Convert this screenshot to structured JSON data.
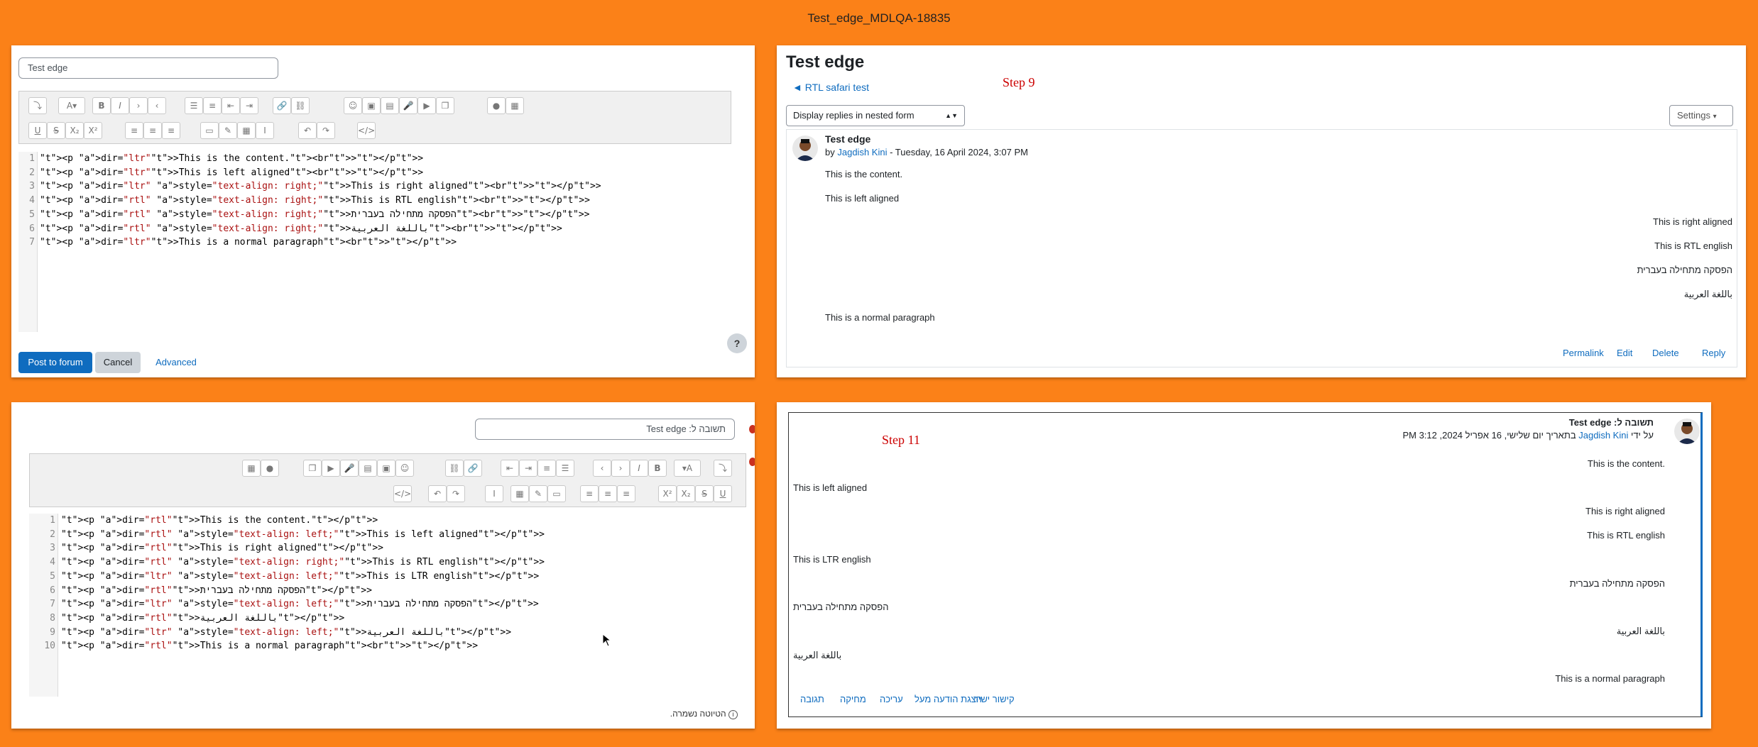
{
  "window_title": "Test_edge_MDLQA-18835",
  "panel_top_left": {
    "subject_value": "Test edge",
    "code_lines": [
      "<p dir=\"ltr\">This is the content.<br></p>",
      "<p dir=\"ltr\">This is left aligned<br></p>",
      "<p dir=\"ltr\" style=\"text-align: right;\">This is right aligned<br></p>",
      "<p dir=\"rtl\" style=\"text-align: right;\">This is RTL english<br></p>",
      "<p dir=\"rtl\" style=\"text-align: right;\">הפסקה מתחילה בעברית<br></p>",
      "<p dir=\"rtl\" style=\"text-align: right;\">باللغة العربية<br></p>",
      "<p dir=\"ltr\">This is a normal paragraph<br></p>"
    ],
    "post_button": "Post to forum",
    "cancel_button": "Cancel",
    "advanced_link": "Advanced",
    "help_icon": "?"
  },
  "panel_top_right": {
    "heading": "Test edge",
    "back_link": "◄ RTL safari test",
    "step_label": "Step 9",
    "display_select": "Display replies in nested form",
    "settings_button": "Settings",
    "post": {
      "subject": "Test edge",
      "by_prefix": "by",
      "author": "Jagdish Kini",
      "date": " - Tuesday, 16 April 2024, 3:07 PM",
      "paragraphs": [
        {
          "text": "This is the content.",
          "align": "left"
        },
        {
          "text": "This is left aligned",
          "align": "left"
        },
        {
          "text": "This is right aligned",
          "align": "right"
        },
        {
          "text": "This is RTL english",
          "align": "right"
        },
        {
          "text": "הפסקה מתחילה בעברית",
          "align": "right"
        },
        {
          "text": "باللغة العربية",
          "align": "right"
        },
        {
          "text": "This is a normal paragraph",
          "align": "left"
        }
      ],
      "actions": [
        "Permalink",
        "Edit",
        "Delete",
        "Reply"
      ]
    }
  },
  "panel_bottom_left": {
    "subject_value": "תשובה ל: Test edge",
    "code_lines": [
      "<p dir=\"rtl\">This is the content.</p>",
      "<p dir=\"rtl\" style=\"text-align: left;\">This is left aligned</p>",
      "<p dir=\"rtl\">This is right aligned</p>",
      "<p dir=\"rtl\" style=\"text-align: right;\">This is RTL english</p>",
      "<p dir=\"ltr\" style=\"text-align: left;\">This is LTR english</p>",
      "<p dir=\"rtl\">הפסקה מתחילה בעברית</p>",
      "<p dir=\"ltr\" style=\"text-align: left;\">הפסקה מתחילה בעברית</p>",
      "<p dir=\"rtl\">باللغة العربية</p>",
      "<p dir=\"ltr\" style=\"text-align: left;\">باللغة العربية</p>",
      "<p dir=\"rtl\">This is a normal paragraph<br></p>"
    ],
    "autosave_notice": "הטיוטה נשמרה."
  },
  "panel_bottom_right": {
    "step_label": "Step 11",
    "post": {
      "subject": "תשובה ל: Test edge",
      "by_prefix": "על ידי",
      "author": "Jagdish Kini",
      "date": "בתאריך יום שלישי, 16 אפריל 2024, 3:12 PM",
      "paragraphs": [
        {
          "text": "This is the content.",
          "align": "right"
        },
        {
          "text": "This is left aligned",
          "align": "left"
        },
        {
          "text": "This is right aligned",
          "align": "right"
        },
        {
          "text": "This is RTL english",
          "align": "right"
        },
        {
          "text": "This is LTR english",
          "align": "left"
        },
        {
          "text": "הפסקה מתחילה בעברית",
          "align": "right"
        },
        {
          "text": "הפסקה מתחילה בעברית",
          "align": "left"
        },
        {
          "text": "باللغة العربية",
          "align": "right"
        },
        {
          "text": "باللغة العربية",
          "align": "left"
        },
        {
          "text": "This is a normal paragraph",
          "align": "right"
        }
      ],
      "actions": [
        "קישור ישיר",
        "הצגת הודעה מעל",
        "עריכה",
        "מחיקה",
        "תגובה"
      ]
    }
  }
}
